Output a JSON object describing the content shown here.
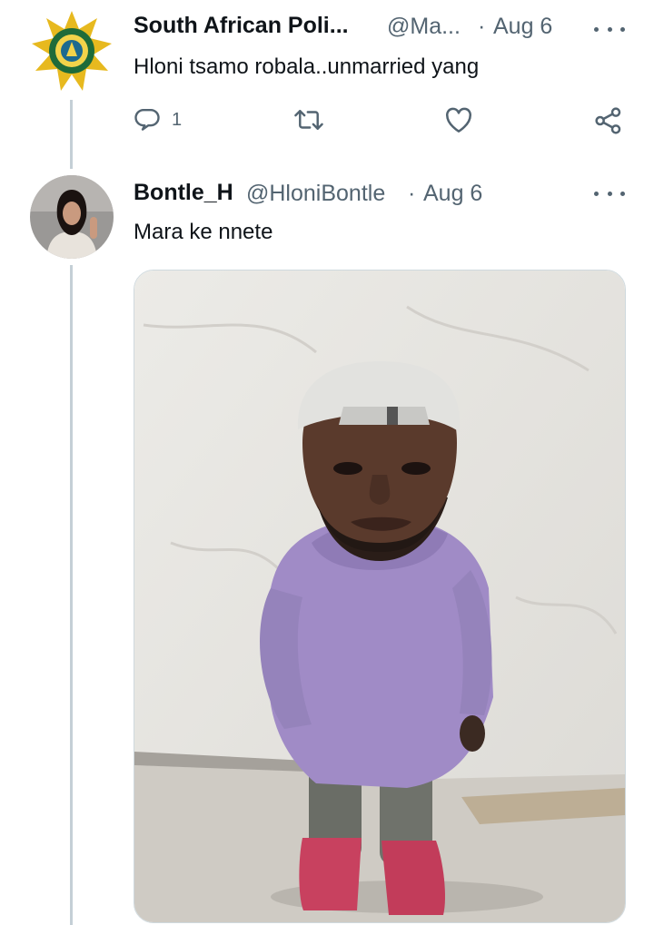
{
  "tweet1": {
    "display_name": "South African Poli...",
    "handle": "@Ma...",
    "separator": "·",
    "date": "Aug 6",
    "text": "Hloni tsamo robala..unmarried yang",
    "avatar_icon": "police-badge-icon",
    "actions": {
      "reply_count": "1",
      "retweet_icon": "retweet-icon",
      "like_icon": "heart-icon",
      "share_icon": "share-icon"
    }
  },
  "tweet2": {
    "display_name": "Bontle_H",
    "handle": "@HloniBontle",
    "separator": "·",
    "date": "Aug 6",
    "text": "Mara ke nnete",
    "avatar_icon": "user-avatar-photo",
    "media_icon": "photo-of-man-in-purple-hoodie-and-white-cap"
  },
  "colors": {
    "text_primary": "#0f1419",
    "text_secondary": "#536471",
    "thread_line": "#c4cfd6",
    "badge_gold": "#e7b91f",
    "badge_green": "#1f6b3a",
    "hoodie_purple": "#a08bc6",
    "boots_pink": "#c8415f"
  }
}
